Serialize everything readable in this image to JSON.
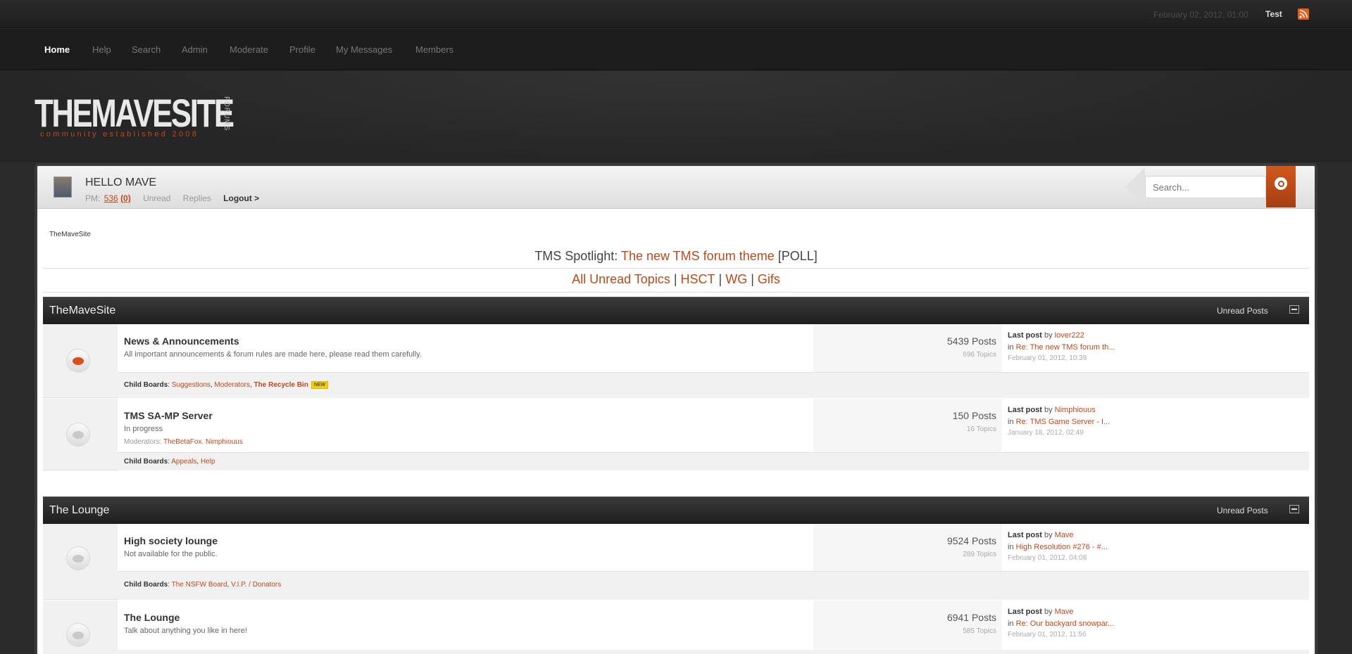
{
  "topbar": {
    "datetime": "February 02, 2012, 01:00",
    "username": "Test",
    "rss_icon": "rss-icon"
  },
  "nav": {
    "items": [
      "Home",
      "Help",
      "Search",
      "Admin",
      "Moderate",
      "Profile",
      "My Messages",
      "Members"
    ],
    "active": "Home"
  },
  "logo": {
    "wordmark": "THEMAVESITE",
    "side_text": "FORUMS",
    "tagline": "community established 2008"
  },
  "userbar": {
    "greeting": "HELLO MAVE",
    "pm_label": "PM:",
    "pm_count": "536",
    "pm_new": "(0)",
    "unread": "Unread",
    "replies": "Replies",
    "logout": "Logout >"
  },
  "search": {
    "placeholder": "Search..."
  },
  "breadcrumb": "TheMaveSite",
  "spotlight": {
    "prefix": "TMS Spotlight:",
    "link": "The new TMS forum theme",
    "suffix": "[POLL]"
  },
  "quick_links": [
    "All Unread Topics",
    "HSCT",
    "WG",
    "Gifs"
  ],
  "quick_sep": "|",
  "categories": [
    {
      "title": "TheMaveSite",
      "unread_label": "Unread Posts",
      "boards": [
        {
          "name": "News & Announcements",
          "description": "All important announcements & forum rules are made here, please read them carefully.",
          "posts": "5439 Posts",
          "topics": "696 Topics",
          "last_post_label": "Last post",
          "last_by": "by",
          "last_user": "lover222",
          "last_in": "in",
          "last_topic": "Re: The new TMS forum th...",
          "last_date": "February 01, 2012, 10:39",
          "child_label": "Child Boards",
          "children": [
            "Suggestions",
            "Moderators",
            "The Recycle Bin"
          ],
          "child_badge": "NEW"
        },
        {
          "name": "TMS SA-MP Server",
          "description": "In progress",
          "moderators_label": "Moderators:",
          "moderators": [
            "TheBetaFox",
            "Nimphiouus"
          ],
          "posts": "150 Posts",
          "topics": "16 Topics",
          "last_post_label": "Last post",
          "last_by": "by",
          "last_user": "Nimphiouus",
          "last_in": "in",
          "last_topic": "Re: TMS Game Server - I...",
          "last_date": "January 18, 2012, 02:49",
          "child_label": "Child Boards",
          "children": [
            "Appeals",
            "Help"
          ]
        }
      ]
    },
    {
      "title": "The Lounge",
      "unread_label": "Unread Posts",
      "boards": [
        {
          "name": "High society lounge",
          "description": "Not available for the public.",
          "posts": "9524 Posts",
          "topics": "289 Topics",
          "last_post_label": "Last post",
          "last_by": "by",
          "last_user": "Mave",
          "last_in": "in",
          "last_topic": "High Resolution #276 - #...",
          "last_date": "February 01, 2012, 04:08",
          "child_label": "Child Boards",
          "children": [
            "The NSFW Board",
            "V.I.P. / Donators"
          ]
        },
        {
          "name": "The Lounge",
          "description": "Talk about anything you like in here!",
          "posts": "6941 Posts",
          "topics": "585 Topics",
          "last_post_label": "Last post",
          "last_by": "by",
          "last_user": "Mave",
          "last_in": "in",
          "last_topic": "Re: Our backyard snowpar...",
          "last_date": "February 01, 2012, 11:56"
        }
      ]
    }
  ],
  "colors": {
    "accent": "#c0481b",
    "category_bar": "#2a2a2a",
    "page_bg": "#2a2a2a"
  }
}
